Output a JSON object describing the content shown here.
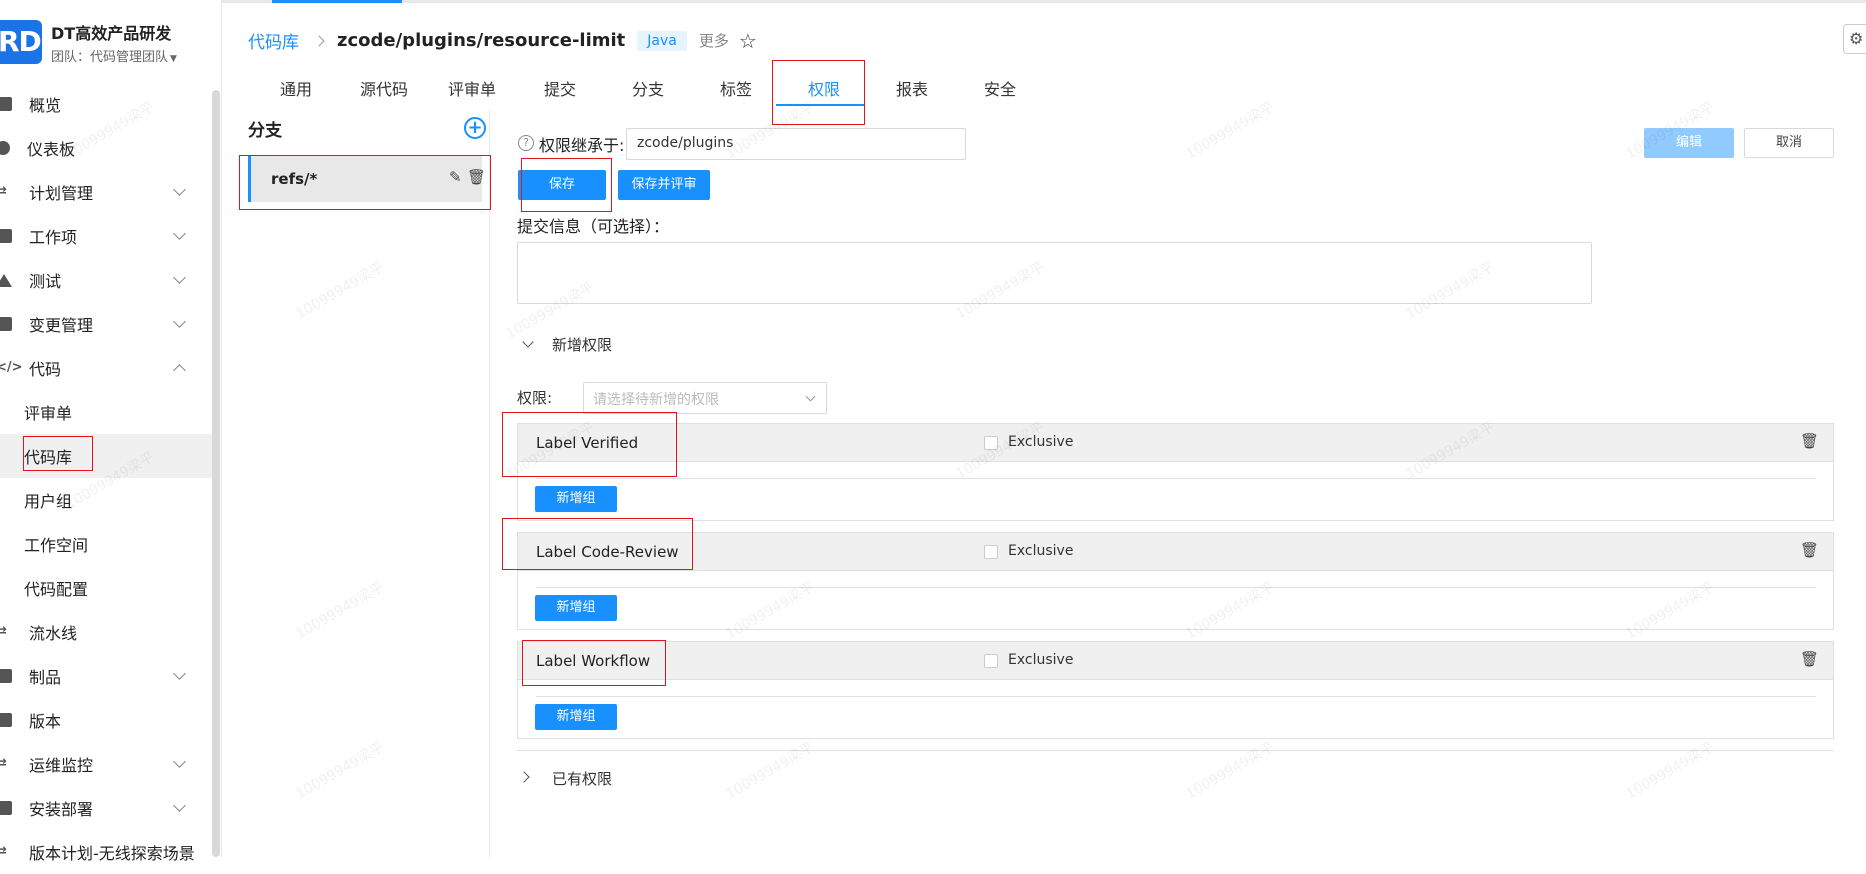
{
  "brand": {
    "logo": "RD",
    "title": "DT高效产品研发",
    "team": "团队：代码管理团队"
  },
  "nav": [
    {
      "label": "概览",
      "icon": "home-icon",
      "chevron": ""
    },
    {
      "label": "仪表板",
      "icon": "dashboard-icon",
      "chevron": ""
    },
    {
      "label": "计划管理",
      "icon": "plan-icon",
      "chevron": "down"
    },
    {
      "label": "工作项",
      "icon": "workitem-icon",
      "chevron": "down"
    },
    {
      "label": "测试",
      "icon": "flask-icon",
      "chevron": "down"
    },
    {
      "label": "变更管理",
      "icon": "change-icon",
      "chevron": "down"
    },
    {
      "label": "代码",
      "icon": "code-icon",
      "chevron": "up"
    },
    {
      "label": "评审单",
      "sub": true
    },
    {
      "label": "代码库",
      "sub": true,
      "active": true
    },
    {
      "label": "用户组",
      "sub": true
    },
    {
      "label": "工作空间",
      "sub": true
    },
    {
      "label": "代码配置",
      "sub": true
    },
    {
      "label": "流水线",
      "icon": "pipeline-icon",
      "chevron": ""
    },
    {
      "label": "制品",
      "icon": "artifact-icon",
      "chevron": "down"
    },
    {
      "label": "版本",
      "icon": "version-icon",
      "chevron": ""
    },
    {
      "label": "运维监控",
      "icon": "monitor-icon",
      "chevron": "down"
    },
    {
      "label": "安装部署",
      "icon": "deploy-icon",
      "chevron": "down"
    },
    {
      "label": "版本计划-无线探索场景",
      "icon": "grid-icon",
      "chevron": ""
    }
  ],
  "header": {
    "breadcrumb_root": "代码库",
    "repo": "zcode/plugins/resource-limit",
    "lang": "Java",
    "more": "更多",
    "star": "☆",
    "settings": "⚙"
  },
  "tabs": [
    "通用",
    "源代码",
    "评审单",
    "提交",
    "分支",
    "标签",
    "权限",
    "报表",
    "安全"
  ],
  "active_tab": "权限",
  "branch_panel": {
    "title": "分支",
    "add": "+",
    "branch": "refs/*"
  },
  "permissions": {
    "help": "?",
    "inherit_label": "权限继承于:",
    "inherit_value": "zcode/plugins",
    "edit": "编辑",
    "cancel": "取消",
    "save": "保存",
    "save_review": "保存并评审",
    "commit_label": "提交信息（可选择）：",
    "add_section": "新增权限",
    "perm_label": "权限:",
    "perm_placeholder": "请选择待新增的权限",
    "labels": [
      {
        "name": "Label Verified",
        "exclusive": "Exclusive",
        "add_group": "新增组"
      },
      {
        "name": "Label Code-Review",
        "exclusive": "Exclusive",
        "add_group": "新增组"
      },
      {
        "name": "Label Workflow",
        "exclusive": "Exclusive",
        "add_group": "新增组"
      }
    ],
    "existing_section": "已有权限"
  },
  "watermark": "10099949梁平"
}
